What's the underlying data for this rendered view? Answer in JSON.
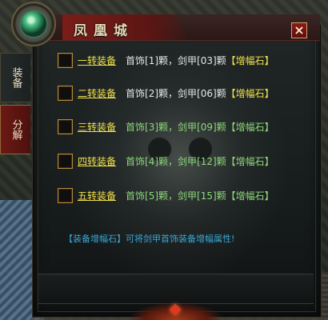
{
  "window": {
    "title": "凤凰城",
    "close_label": "×"
  },
  "tabs": [
    {
      "label": "装备"
    },
    {
      "label": "分解"
    }
  ],
  "rows": [
    {
      "link": "一转装备",
      "d1": "首饰[1]颗，剑甲[03]颗",
      "gem": "【增幅石】",
      "style": "white"
    },
    {
      "link": "二转装备",
      "d1": "首饰[2]颗，剑甲[06]颗",
      "gem": "【增幅石】",
      "style": "white"
    },
    {
      "link": "三转装备",
      "d1": "首饰[3]颗，剑甲[09]颗",
      "gem": "【增幅石】",
      "style": "green"
    },
    {
      "link": "四转装备",
      "d1": "首饰[4]颗，剑甲[12]颗",
      "gem": "【增幅石】",
      "style": "green"
    },
    {
      "link": "五转装备",
      "d1": "首饰[5]颗，剑甲[15]颗",
      "gem": "【增幅石】",
      "style": "green"
    }
  ],
  "tip": "【装备增幅石】可将剑甲首饰装备增幅属性!",
  "colors": {
    "title_red": "#7a1d19",
    "link_yellow": "#f2e14a",
    "green_text": "#8dd87a",
    "tip_blue": "#39a8d6"
  },
  "icons": [
    "orb-icon",
    "close-icon",
    "skull-watermark"
  ]
}
